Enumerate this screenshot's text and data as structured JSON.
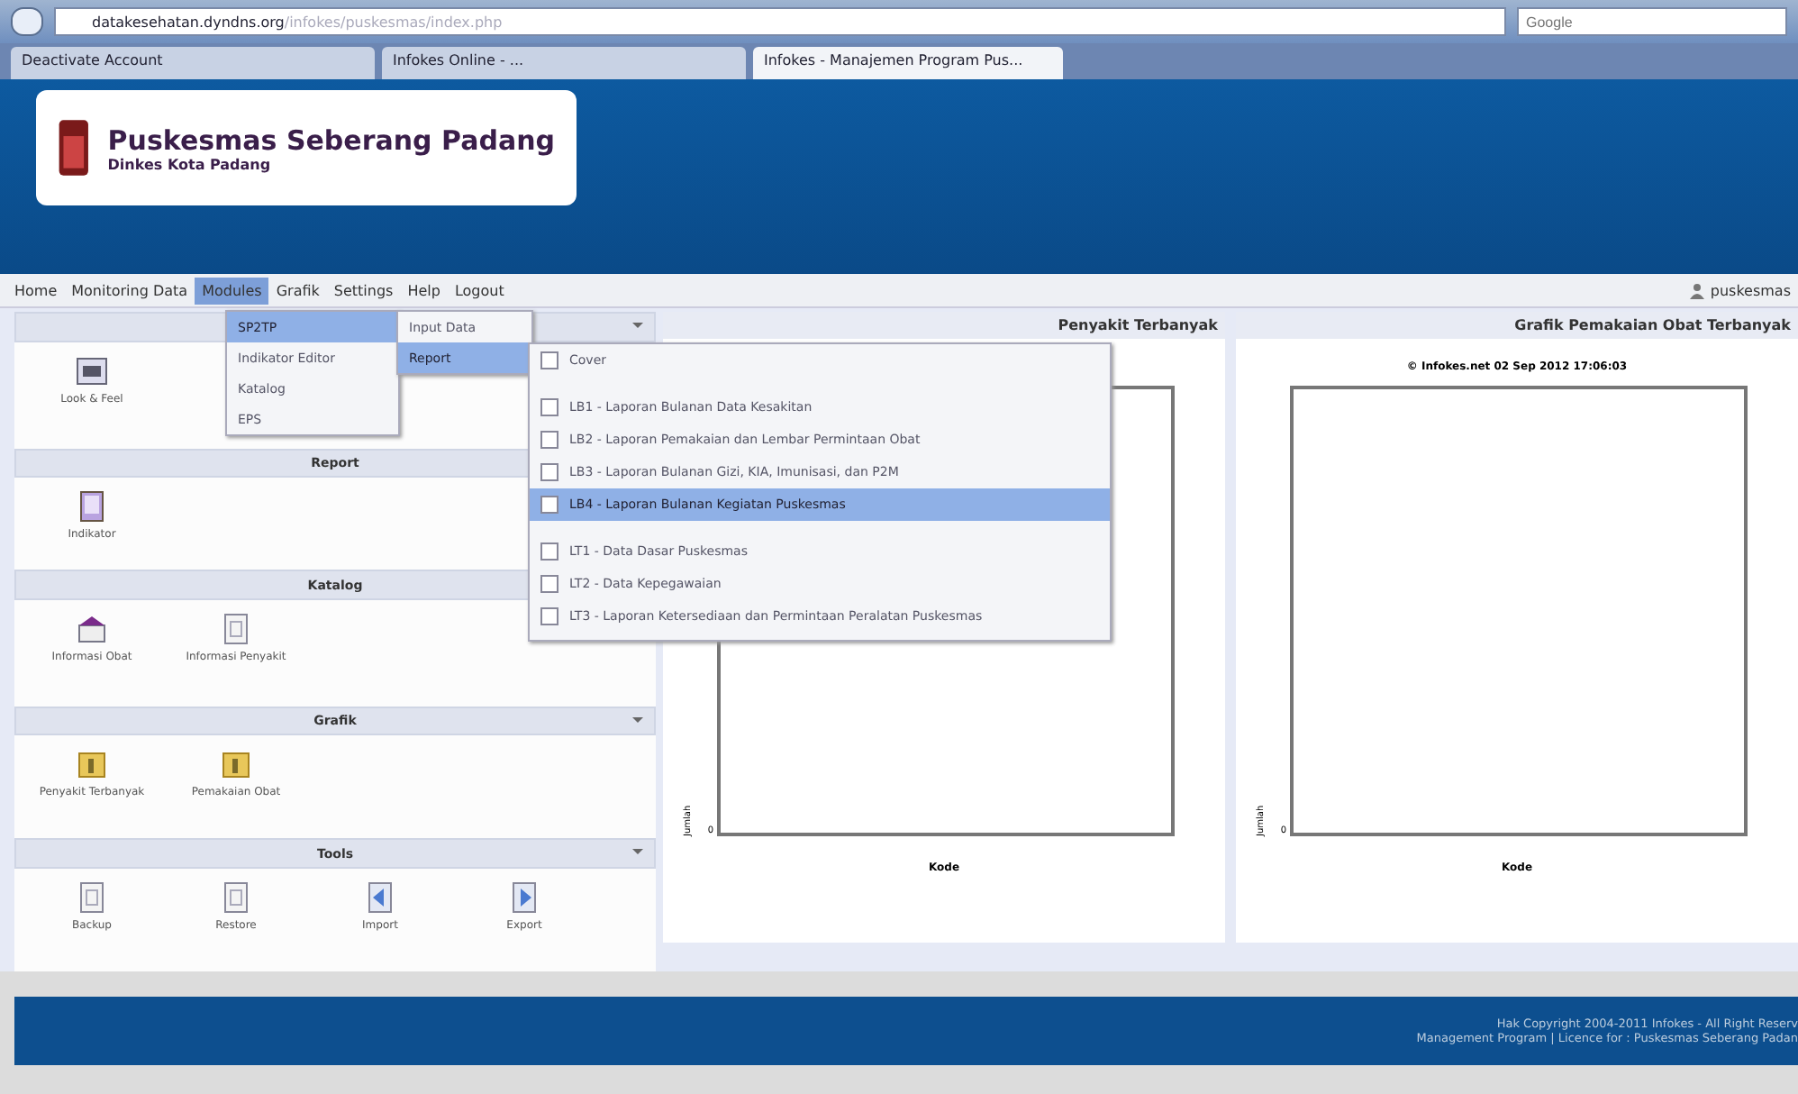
{
  "browser": {
    "url": "datakesehatan.dyndns.org",
    "url_path": "/infokes/puskesmas/index.php",
    "search": {
      "placeholder": "Google"
    },
    "tabs": [
      {
        "label": "Deactivate Account",
        "selected": false
      },
      {
        "label": "Infokes Online - ...",
        "selected": false
      },
      {
        "label": "Infokes - Manajemen Program Pus...",
        "selected": true
      }
    ]
  },
  "header": {
    "title": "Puskesmas Seberang Padang",
    "subtitle": "Dinkes Kota Padang"
  },
  "menu": {
    "items": [
      {
        "label": "Home",
        "selected": false
      },
      {
        "label": "Monitoring Data",
        "selected": false
      },
      {
        "label": "Modules",
        "selected": true
      },
      {
        "label": "Grafik",
        "selected": false
      },
      {
        "label": "Settings",
        "selected": false
      },
      {
        "label": "Help",
        "selected": false
      },
      {
        "label": "Logout",
        "selected": false
      }
    ],
    "user": "puskesmas"
  },
  "dropdown": [
    {
      "label": "SP2TP",
      "selected": true
    },
    {
      "label": "Indikator Editor",
      "selected": false
    },
    {
      "label": "Katalog",
      "selected": false
    },
    {
      "label": "EPS",
      "selected": false
    }
  ],
  "submenu": [
    {
      "label": "Input Data",
      "selected": false
    },
    {
      "label": "Report",
      "selected": true
    }
  ],
  "report_groups": [
    [
      {
        "label": "Cover",
        "selected": false
      }
    ],
    [
      {
        "label": "LB1 - Laporan Bulanan Data Kesakitan",
        "selected": false
      },
      {
        "label": "LB2 - Laporan Pemakaian dan Lembar Permintaan Obat",
        "selected": false
      },
      {
        "label": "LB3 - Laporan Bulanan Gizi, KIA, Imunisasi, dan P2M",
        "selected": false
      },
      {
        "label": "LB4 - Laporan Bulanan Kegiatan Puskesmas",
        "selected": true
      }
    ],
    [
      {
        "label": "LT1 - Data Dasar Puskesmas",
        "selected": false
      },
      {
        "label": "LT2 - Data Kepegawaian",
        "selected": false
      },
      {
        "label": "LT3 - Laporan Ketersediaan dan Permintaan Peralatan Puskesmas",
        "selected": false
      }
    ]
  ],
  "sections": [
    {
      "items": [
        {
          "label": "Look & Feel",
          "kind": "gallery"
        }
      ]
    },
    {
      "title": "Report",
      "items": [
        {
          "label": "Indikator",
          "kind": "book"
        }
      ]
    },
    {
      "title": "Katalog",
      "items": [
        {
          "label": "Informasi Obat",
          "kind": "box"
        },
        {
          "label": "Informasi Penyakit",
          "kind": "doc"
        }
      ]
    },
    {
      "title": "Grafik",
      "items": [
        {
          "label": "Penyakit Terbanyak",
          "kind": "folder"
        },
        {
          "label": "Pemakaian Obat",
          "kind": "folder"
        }
      ]
    },
    {
      "title": "Tools",
      "items": [
        {
          "label": "Backup",
          "kind": "doc"
        },
        {
          "label": "Restore",
          "kind": "doc"
        },
        {
          "label": "Import",
          "kind": "left"
        },
        {
          "label": "Export",
          "kind": "right"
        }
      ]
    }
  ],
  "charts": [
    {
      "title": "Penyakit Terbanyak",
      "ylabel": "Jumlah",
      "xlabel": "Kode",
      "zero": "0"
    },
    {
      "title": "Grafik Pemakaian Obat Terbanyak",
      "stamp": "© Infokes.net 02 Sep 2012 17:06:03",
      "ylabel": "Jumlah",
      "xlabel": "Kode",
      "zero": "0"
    }
  ],
  "footer": [
    "Hak Copyright 2004-2011 Infokes - All Right Reserv",
    "Management Program | Licence for : Puskesmas Seberang Padan"
  ]
}
